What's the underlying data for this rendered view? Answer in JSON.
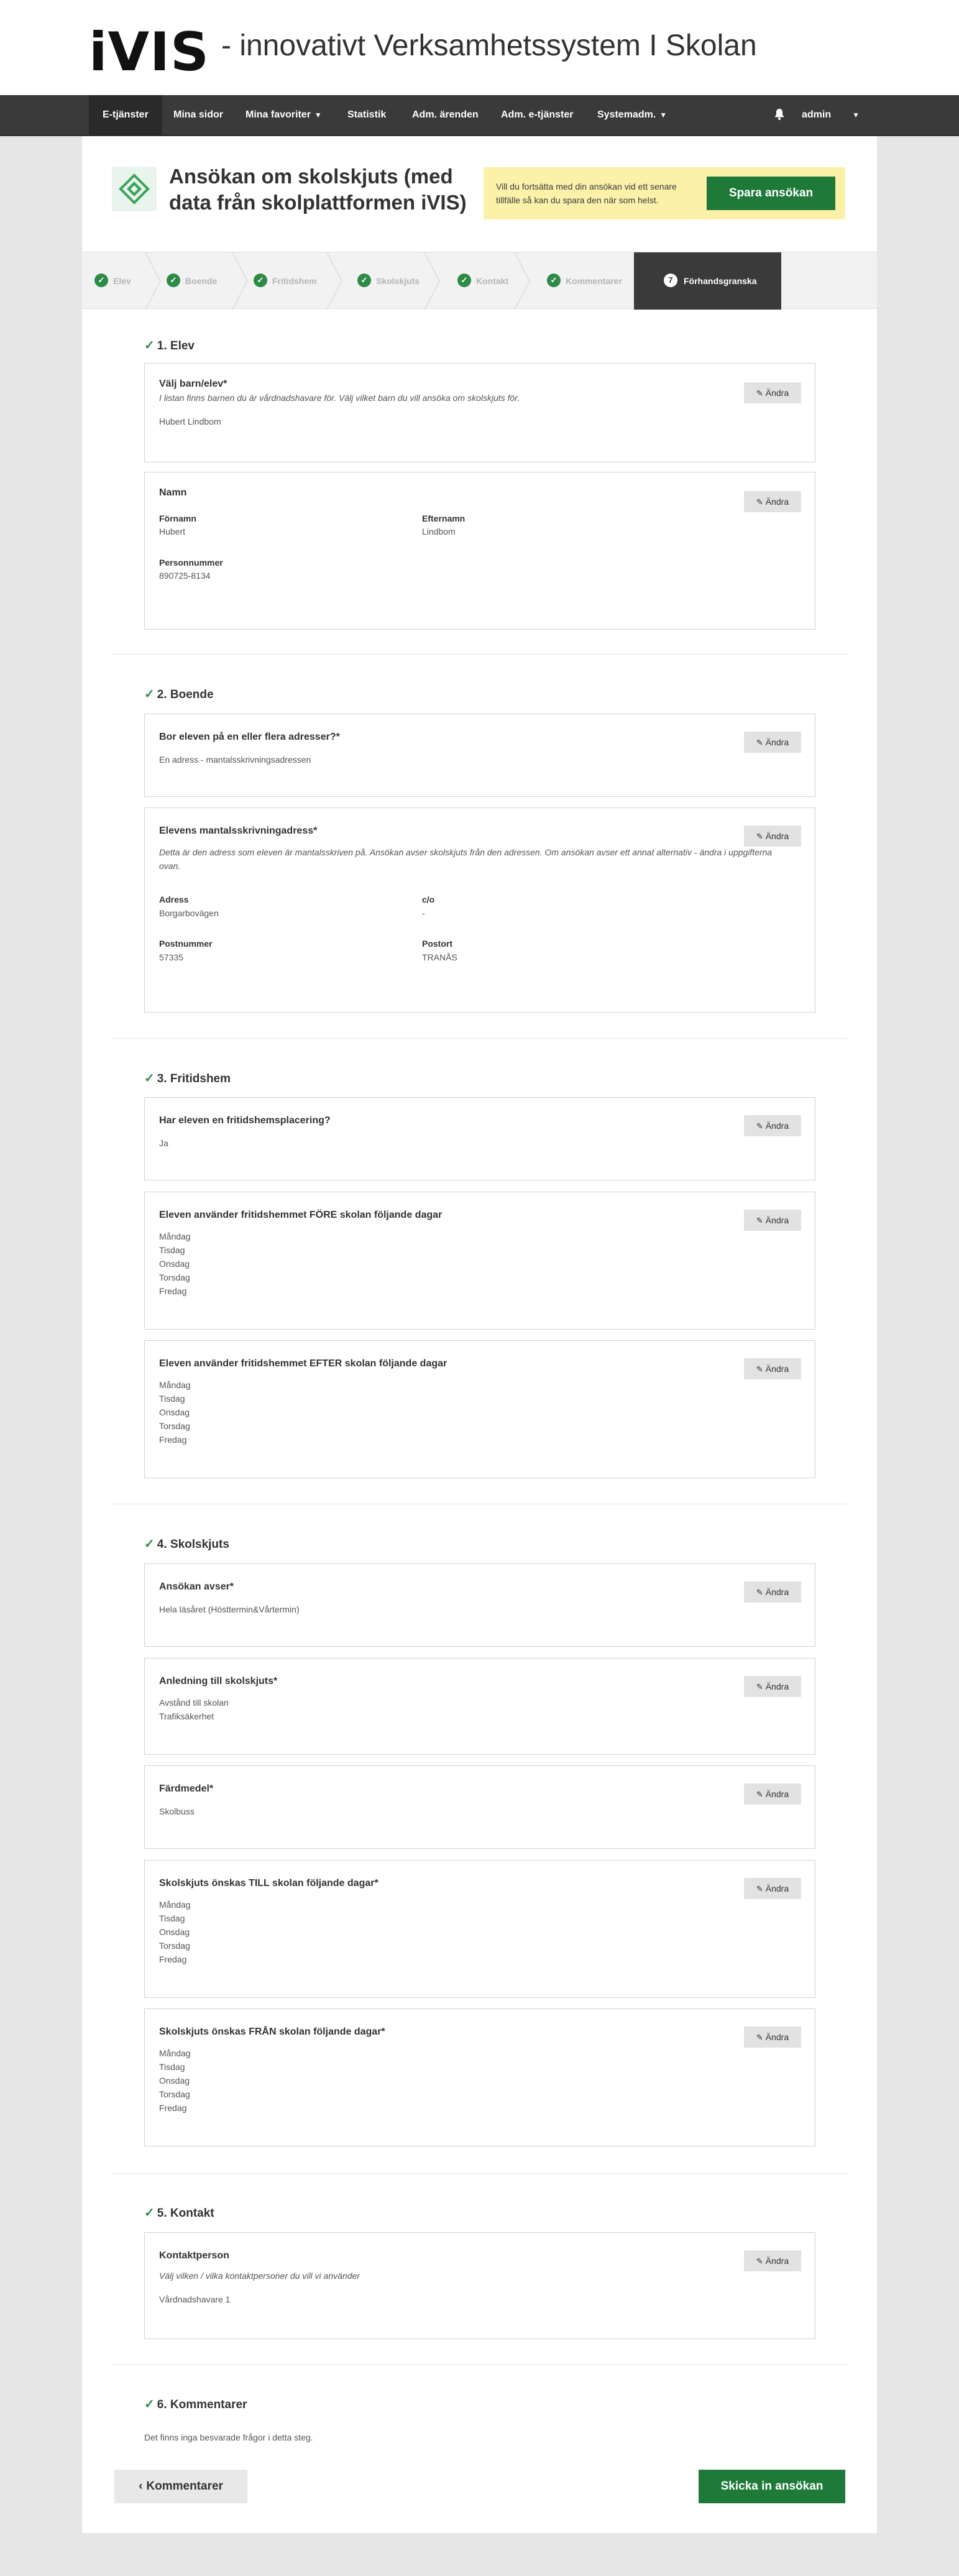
{
  "header": {
    "logo": "iVIS",
    "tagline": "- innovativt Verksamhetssystem I Skolan"
  },
  "nav": {
    "items": [
      {
        "label": "E-tjänster"
      },
      {
        "label": "Mina sidor"
      },
      {
        "label": "Mina favoriter"
      },
      {
        "label": "Statistik"
      },
      {
        "label": "Adm. ärenden"
      },
      {
        "label": "Adm. e-tjänster"
      },
      {
        "label": "Systemadm."
      }
    ],
    "user": "admin"
  },
  "page": {
    "title": "Ansökan om skolskjuts (med data från skolplattformen iVIS)",
    "save_note": "Vill du fortsätta med din ansökan vid ett senare tillfälle så kan du spara den när som helst.",
    "save_button": "Spara ansökan"
  },
  "steps": [
    {
      "label": "Elev"
    },
    {
      "label": "Boende"
    },
    {
      "label": "Fritidshem"
    },
    {
      "label": "Skolskjuts"
    },
    {
      "label": "Kontakt"
    },
    {
      "label": "Kommentarer"
    },
    {
      "label": "Förhandsgranska",
      "number": "7"
    }
  ],
  "edit_label": "Ändra",
  "sections": {
    "s1": {
      "title": "1. Elev",
      "child_q": "Välj barn/elev*",
      "child_help": "I listan finns barnen du är vårdnadshavare för. Välj vilket barn du vill ansöka om skolskjuts för.",
      "child_val": "Hubert Lindbom",
      "name_q": "Namn",
      "first_lbl": "Förnamn",
      "first_val": "Hubert",
      "last_lbl": "Efternamn",
      "last_val": "Lindbom",
      "pnr_lbl": "Personnummer",
      "pnr_val": "890725-8134"
    },
    "s2": {
      "title": "2. Boende",
      "addr_q": "Bor eleven på en eller flera adresser?*",
      "addr_val": "En adress - mantalsskrivningsadressen",
      "mant_q": "Elevens mantalsskrivningadress*",
      "mant_help": "Detta är den adress som eleven är mantalsskriven på. Ansökan avser skolskjuts från den adressen. Om ansökan avser ett annat alternativ - ändra i uppgifterna ovan.",
      "adr_lbl": "Adress",
      "adr_val": "Borgarbovägen",
      "co_lbl": "c/o",
      "co_val": "-",
      "post_lbl": "Postnummer",
      "post_val": "57335",
      "ort_lbl": "Postort",
      "ort_val": "TRANÅS"
    },
    "s3": {
      "title": "3. Fritidshem",
      "q1": "Har eleven en fritidshemsplacering?",
      "a1": "Ja",
      "q2": "Eleven använder fritidshemmet FÖRE skolan följande dagar",
      "q3": "Eleven använder fritidshemmet EFTER skolan följande dagar"
    },
    "s4": {
      "title": "4. Skolskjuts",
      "q1": "Ansökan avser*",
      "a1": "Hela läsåret (Hösttermin&Vårtermin)",
      "q2": "Anledning till skolskjuts*",
      "a2a": "Avstånd till skolan",
      "a2b": "Trafiksäkerhet",
      "q3": "Färdmedel*",
      "a3": "Skolbuss",
      "q4": "Skolskjuts önskas TILL skolan följande dagar*",
      "q5": "Skolskjuts önskas FRÅN skolan följande dagar*"
    },
    "s5": {
      "title": "5. Kontakt",
      "q1": "Kontaktperson",
      "help": "Välj vilken / vilka kontaktpersoner du vill vi använder",
      "a1": "Vårdnadshavare 1"
    },
    "s6": {
      "title": "6. Kommentarer",
      "note": "Det finns inga besvarade frågor i detta steg."
    }
  },
  "days": [
    "Måndag",
    "Tisdag",
    "Onsdag",
    "Torsdag",
    "Fredag"
  ],
  "footer": {
    "back": "Kommentarer",
    "submit": "Skicka in ansökan"
  }
}
